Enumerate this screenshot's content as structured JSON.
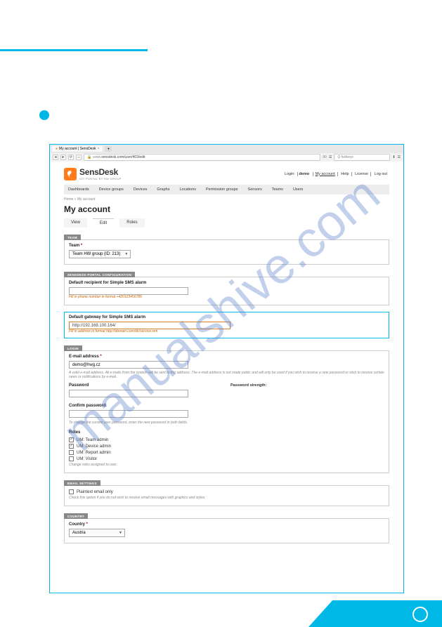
{
  "watermark": "manualshive.com",
  "browser": {
    "tab_title": "My account | SensDesk",
    "url_prefix": "www.",
    "url": "sensdesk.com/user/403/edit",
    "ssl_indicator": "90",
    "search_placeholder": "Q hotkeys"
  },
  "header": {
    "brand": "SensDesk",
    "tagline": "IOT PORTAL BY HW GROUP",
    "login_label": "Login:",
    "login_user": "demo",
    "links": {
      "account": "My account",
      "help": "Help",
      "license": "License",
      "logout": "Log out"
    }
  },
  "nav": [
    "Dashboards",
    "Device groups",
    "Devices",
    "Graphs",
    "Locations",
    "Permission groups",
    "Sensors",
    "Teams",
    "Users"
  ],
  "breadcrumb": "Home » My account",
  "page_title": "My account",
  "subtabs": {
    "view": "View",
    "edit": "Edit",
    "roles": "Roles"
  },
  "team": {
    "section": "TEAM",
    "label": "Team",
    "value": "Team HW group (ID: 213)"
  },
  "portal": {
    "section": "SENSDESК PORTAL CONFIGURATION",
    "sms_recipient_label": "Default recipient for Simple SMS alarm",
    "sms_recipient_value": "",
    "sms_recipient_hint": "Fill in phone number in format +420123456789",
    "gateway_label": "Default gateway for Simple SMS alarm",
    "gateway_value": "http://192.168.100.164/",
    "gateway_hint": "Fill in address in format http://domain.com/dir/service.xml"
  },
  "login": {
    "section": "LOGIN",
    "email_label": "E-mail address",
    "email_value": "demo@hwg.cz",
    "email_hint": "A valid e-mail address. All e-mails from the system will be sent to this address. The e-mail address is not made public and will only be used if you wish to receive a new password or wish to receive certain news or notifications by e-mail.",
    "pw_label": "Password",
    "pw_strength": "Password strength:",
    "pw_confirm_label": "Confirm password",
    "pw_hint": "To change the current user password, enter the new password in both fields.",
    "roles_label": "Roles",
    "roles": [
      {
        "label": "UM: Team admin",
        "checked": true
      },
      {
        "label": "UM: Device admin",
        "checked": true
      },
      {
        "label": "UM: Report admin",
        "checked": false
      },
      {
        "label": "UM: Visitor",
        "checked": false
      }
    ],
    "roles_hint": "Change roles assigned to user."
  },
  "email_settings": {
    "section": "EMAIL SETTINGS",
    "option": "Plaintext email only",
    "hint": "Check this option if you do not wish to receive email messages with graphics and styles."
  },
  "country": {
    "section": "COUNTRY",
    "label": "Country",
    "value": "Austria"
  }
}
